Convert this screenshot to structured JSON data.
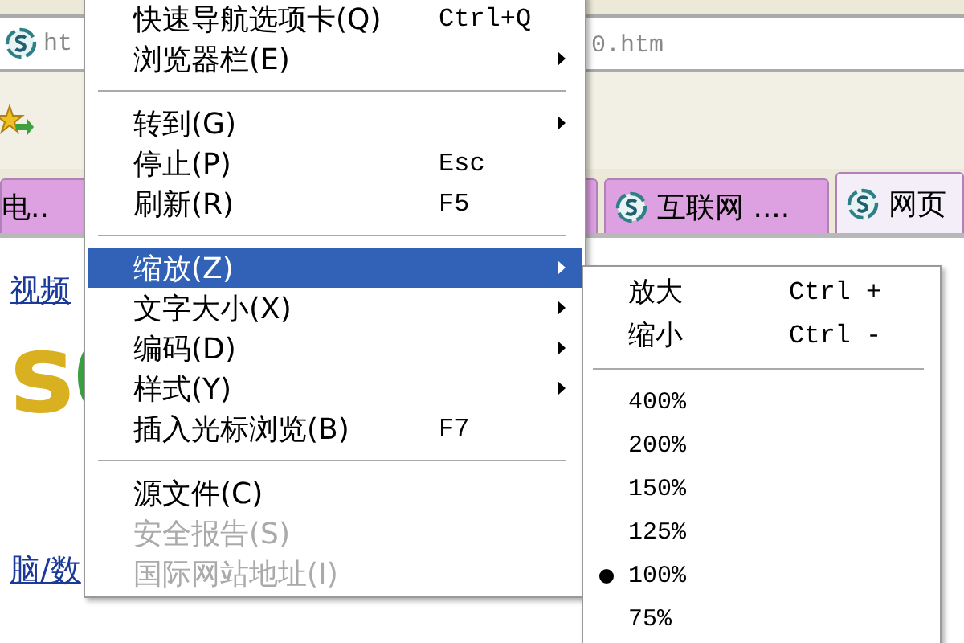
{
  "browser": {
    "address_bar": {
      "left_text": "ht",
      "right_text": "0.htm"
    },
    "tabs": [
      {
        "label": "电..",
        "selected": false
      },
      {
        "label": "互联网 ....",
        "selected": false
      },
      {
        "label": "网页",
        "selected": true
      }
    ],
    "page": {
      "logo": "s",
      "links": [
        "视频",
        "脑/数"
      ]
    }
  },
  "menu": {
    "items": [
      {
        "kind": "item",
        "label": "快速导航选项卡(Q)",
        "shortcut": "Ctrl+Q",
        "submenu": false,
        "disabled": false,
        "selected": false
      },
      {
        "kind": "item",
        "label": "浏览器栏(E)",
        "submenu": true,
        "disabled": false,
        "selected": false
      },
      {
        "kind": "separator"
      },
      {
        "kind": "item",
        "label": "转到(G)",
        "submenu": true,
        "disabled": false,
        "selected": false
      },
      {
        "kind": "item",
        "label": "停止(P)",
        "shortcut": "Esc",
        "submenu": false,
        "disabled": false,
        "selected": false
      },
      {
        "kind": "item",
        "label": "刷新(R)",
        "shortcut": "F5",
        "submenu": false,
        "disabled": false,
        "selected": false
      },
      {
        "kind": "separator"
      },
      {
        "kind": "item",
        "label": "缩放(Z)",
        "submenu": true,
        "disabled": false,
        "selected": true
      },
      {
        "kind": "item",
        "label": "文字大小(X)",
        "submenu": true,
        "disabled": false,
        "selected": false
      },
      {
        "kind": "item",
        "label": "编码(D)",
        "submenu": true,
        "disabled": false,
        "selected": false
      },
      {
        "kind": "item",
        "label": "样式(Y)",
        "submenu": true,
        "disabled": false,
        "selected": false
      },
      {
        "kind": "item",
        "label": "插入光标浏览(B)",
        "shortcut": "F7",
        "submenu": false,
        "disabled": false,
        "selected": false
      },
      {
        "kind": "separator"
      },
      {
        "kind": "item",
        "label": "源文件(C)",
        "submenu": false,
        "disabled": false,
        "selected": false
      },
      {
        "kind": "item",
        "label": "安全报告(S)",
        "submenu": false,
        "disabled": true,
        "selected": false
      },
      {
        "kind": "item",
        "label": "国际网站地址(I)",
        "submenu": false,
        "disabled": true,
        "selected": false
      }
    ]
  },
  "zoom_menu": {
    "items": [
      {
        "kind": "command",
        "label": "放大",
        "shortcut": "Ctrl +"
      },
      {
        "kind": "command",
        "label": "缩小",
        "shortcut": "Ctrl -"
      },
      {
        "kind": "separator"
      },
      {
        "kind": "radio",
        "label": "400%",
        "selected": false
      },
      {
        "kind": "radio",
        "label": "200%",
        "selected": false
      },
      {
        "kind": "radio",
        "label": "150%",
        "selected": false
      },
      {
        "kind": "radio",
        "label": "125%",
        "selected": false
      },
      {
        "kind": "radio",
        "label": "100%",
        "selected": true
      },
      {
        "kind": "radio",
        "label": "75%",
        "selected": false
      }
    ]
  }
}
